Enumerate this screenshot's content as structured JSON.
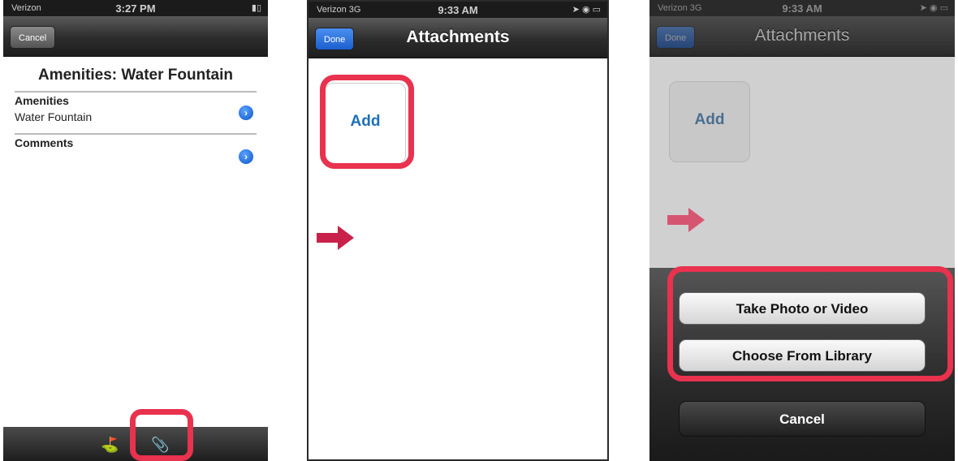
{
  "screen1": {
    "status": {
      "carrier": "Verizon",
      "time": "3:27 PM",
      "right": ""
    },
    "nav": {
      "cancel_label": "Cancel"
    },
    "title": "Amenities: Water Fountain",
    "fields": [
      {
        "label": "Amenities",
        "value": "Water Fountain"
      },
      {
        "label": "Comments",
        "value": ""
      }
    ],
    "disclosure_glyph": "›",
    "toolbar": {
      "location_icon": "location-icon",
      "paperclip_icon": "paperclip-icon"
    }
  },
  "screen2": {
    "status": {
      "carrier": "Verizon 3G",
      "time": "9:33 AM",
      "right": ""
    },
    "nav": {
      "done_label": "Done",
      "title": "Attachments"
    },
    "add_label": "Add"
  },
  "screen3": {
    "status": {
      "carrier": "Verizon 3G",
      "time": "9:33 AM",
      "right": ""
    },
    "nav": {
      "done_label": "Done",
      "title": "Attachments"
    },
    "add_label": "Add",
    "sheet": {
      "take_photo_label": "Take Photo or Video",
      "choose_library_label": "Choose From Library",
      "cancel_label": "Cancel"
    }
  },
  "colors": {
    "highlight": "#e8324e",
    "arrow": "#c8224a",
    "link_blue": "#1e6fb6"
  }
}
